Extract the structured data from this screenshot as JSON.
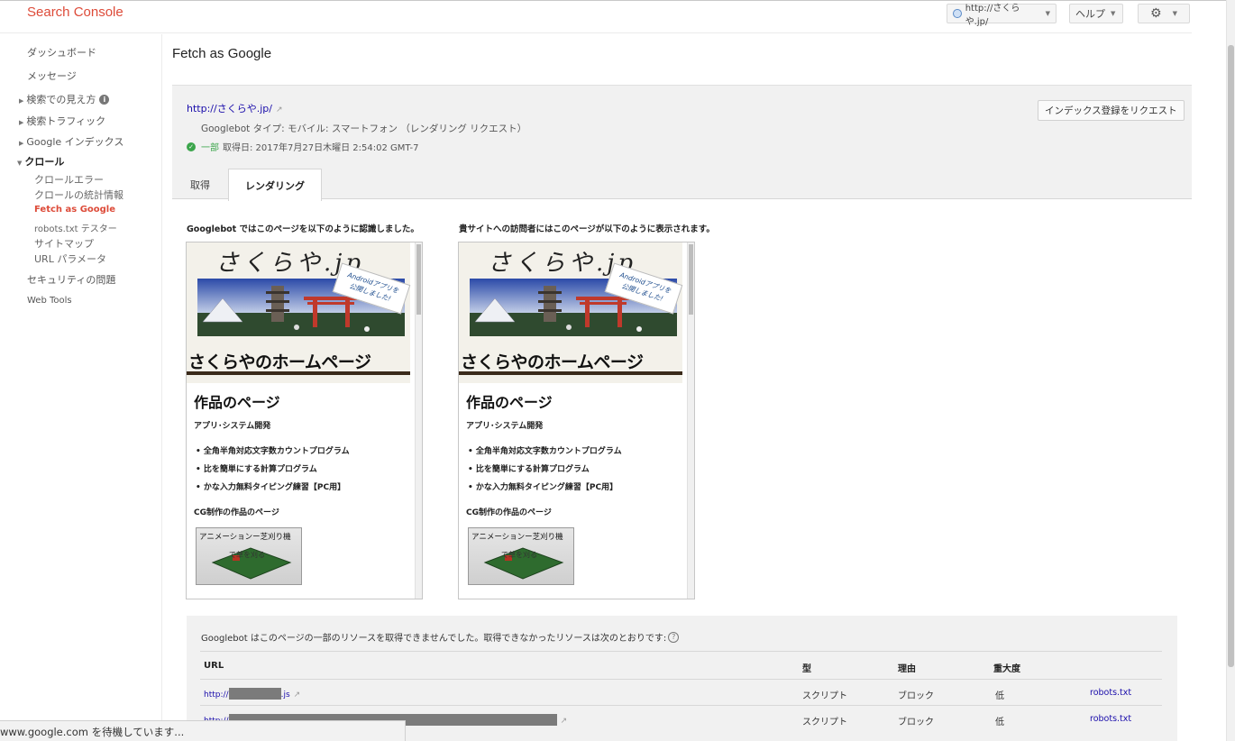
{
  "app": {
    "title": "Search Console"
  },
  "header": {
    "property": "http://さくらや.jp/",
    "help_label": "ヘルプ",
    "settings_icon": "gear-icon"
  },
  "sidebar": {
    "items": [
      {
        "label": "ダッシュボード"
      },
      {
        "label": "メッセージ"
      },
      {
        "label": "検索での見え方"
      },
      {
        "label": "検索トラフィック"
      },
      {
        "label": "Google インデックス"
      },
      {
        "label": "クロール"
      },
      {
        "label": "クロールエラー"
      },
      {
        "label": "クロールの統計情報"
      },
      {
        "label": "Fetch as Google"
      },
      {
        "label": "robots.txt テスター"
      },
      {
        "label": "サイトマップ"
      },
      {
        "label": "URL パラメータ"
      },
      {
        "label": "セキュリティの問題"
      },
      {
        "label": "Web Tools"
      }
    ]
  },
  "main": {
    "title": "Fetch as Google",
    "site_url": "http://さくらや.jp/",
    "bot_type": "Googlebot タイプ: モバイル: スマートフォン （レンダリング リクエスト）",
    "status_partial": "一部",
    "status_fetched": "取得日: 2017年7月27日木曜日 2:54:02 GMT-7",
    "request_index_label": "インデックス登録をリクエスト",
    "tabs": [
      {
        "label": "取得"
      },
      {
        "label": "レンダリング"
      }
    ],
    "caption_googlebot": "Googlebot ではこのページを以下のように認識しました。",
    "caption_visitor": "貴サイトへの訪問者にはこのページが以下のように表示されます。"
  },
  "preview": {
    "banner_title": "さくらや.jp",
    "ribbon_line1": "Androidアプリを",
    "ribbon_line2": "公開しました!",
    "home_title": "さくらやのホームページ",
    "works_heading": "作品のページ",
    "sub_heading": "アプリ･システム開発",
    "bullets": [
      "全角半角対応文字数カウントプログラム",
      "比を簡単にする計算プログラム",
      "かな入力無料タイピング練習【PC用】"
    ],
    "cg_heading": "CG制作の作品のページ",
    "thumb_label": "アニメーションー芝刈り機",
    "thumb_sub": "で草を刈る"
  },
  "resources": {
    "message": "Googlebot はこのページの一部のリソースを取得できませんでした。取得できなかったリソースは次のとおりです:",
    "columns": {
      "url": "URL",
      "type": "型",
      "reason": "理由",
      "severity": "重大度"
    },
    "rows": [
      {
        "url_prefix": "http://",
        "url_suffix": ".js",
        "type": "スクリプト",
        "reason": "ブロック",
        "severity": "低",
        "link": "robots.txt"
      },
      {
        "url_prefix": "http://",
        "url_suffix": "",
        "type": "スクリプト",
        "reason": "ブロック",
        "severity": "低",
        "link": "robots.txt"
      }
    ]
  },
  "statusbar": {
    "text": "www.google.com を待機しています..."
  },
  "colors": {
    "brand": "#dd4b39",
    "link": "#1a0dab",
    "ok": "#3ba54b"
  }
}
